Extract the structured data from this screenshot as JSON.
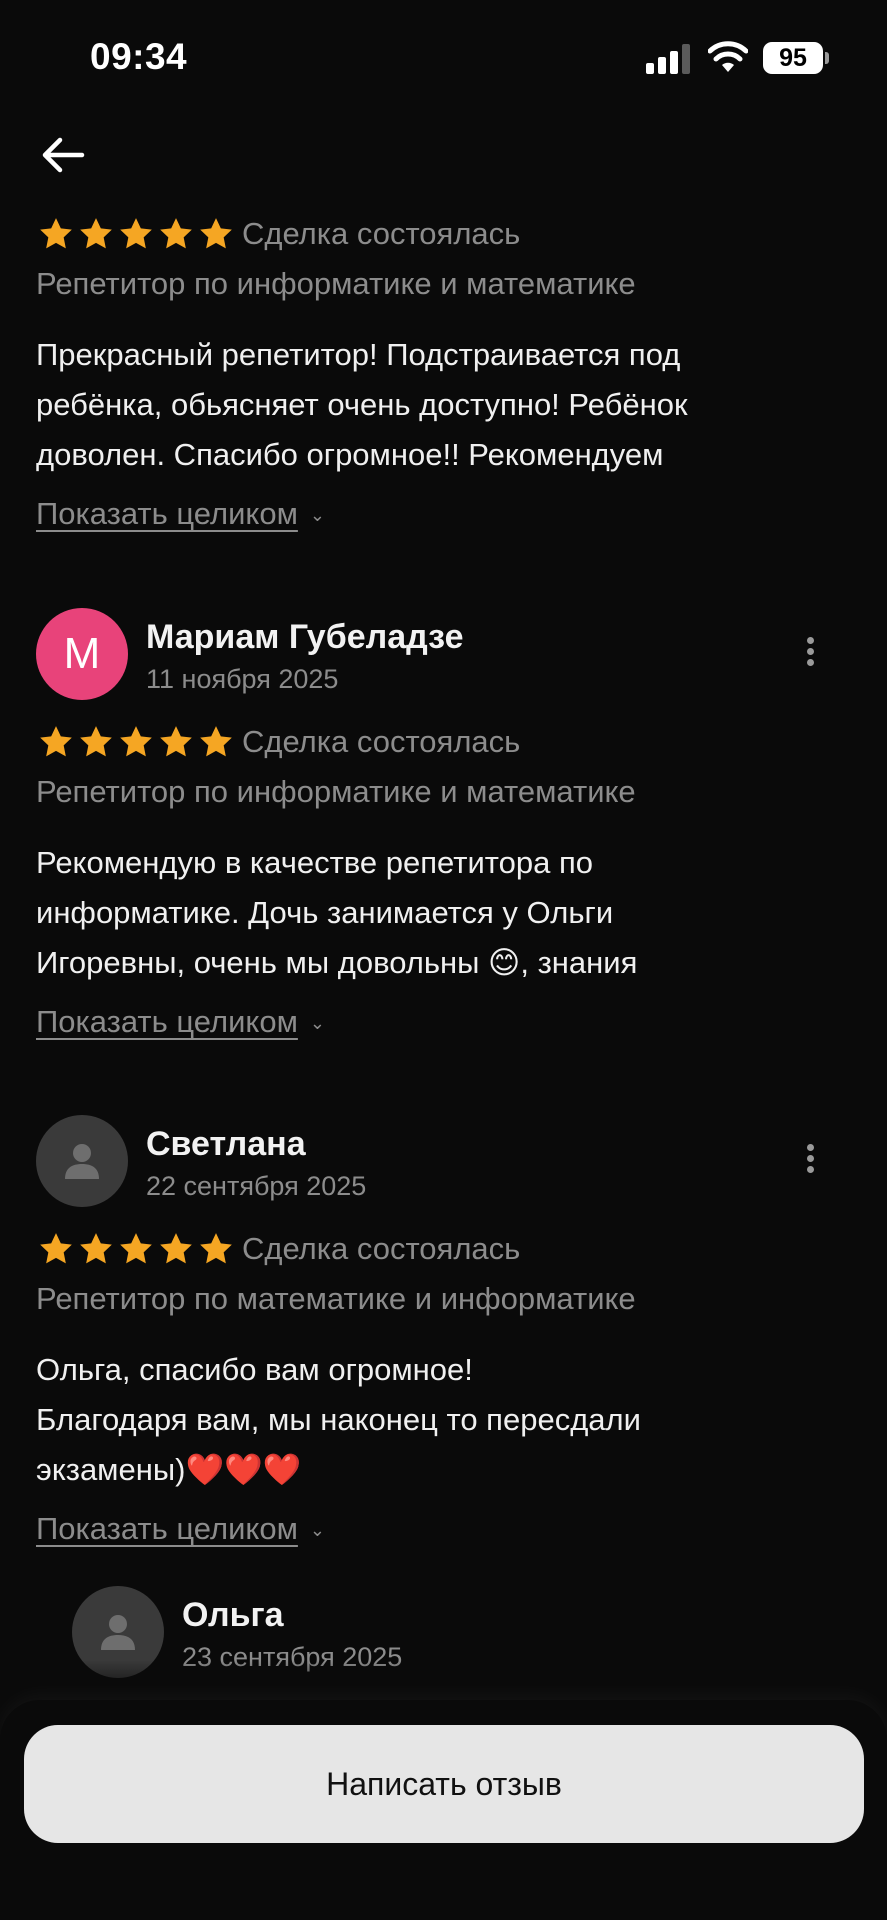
{
  "status_bar": {
    "time": "09:34",
    "battery_level": "95",
    "signal_icon": "cellular-signal-icon",
    "wifi_icon": "wifi-icon"
  },
  "nav": {
    "back_icon": "arrow-left-icon"
  },
  "reviews": [
    {
      "rating": 5,
      "deal_status": "Сделка состоялась",
      "service": "Репетитор по информатике и математике",
      "text_lines": [
        "Прекрасный репетитор! Подстраивается под",
        "ребёнка, обьясняет очень доступно! Ребёнок",
        "доволен. Спасибо огромное!! Рекомендуем"
      ],
      "show_more": "Показать целиком"
    },
    {
      "author": "Мариам Губеладзе",
      "avatar_letter": "М",
      "date": "11 ноября 2025",
      "rating": 5,
      "deal_status": "Сделка состоялась",
      "service": "Репетитор по информатике и математике",
      "text_lines": [
        "Рекомендую в качестве репетитора по",
        "информатике. Дочь занимается у Ольги",
        "Игоревны, очень мы довольны 😊, знания"
      ],
      "show_more": "Показать целиком"
    },
    {
      "author": "Светлана",
      "date": "22 сентября 2025",
      "rating": 5,
      "deal_status": "Сделка состоялась",
      "service": "Репетитор по математике и информатике",
      "text_lines": [
        "Ольга, спасибо вам огромное!",
        "Благодаря вам, мы наконец то пересдали",
        "экзамены)❤️❤️❤️"
      ],
      "show_more": "Показать целиком",
      "reply": {
        "author": "Ольга",
        "date": "23 сентября 2025"
      }
    }
  ],
  "colors": {
    "background": "#0a0a0a",
    "star": "#f5a623",
    "avatar_pink": "#e8437a",
    "muted_text": "#8c8c8c",
    "button_bg": "#e6e6e6"
  },
  "footer": {
    "write_review_label": "Написать отзыв"
  }
}
